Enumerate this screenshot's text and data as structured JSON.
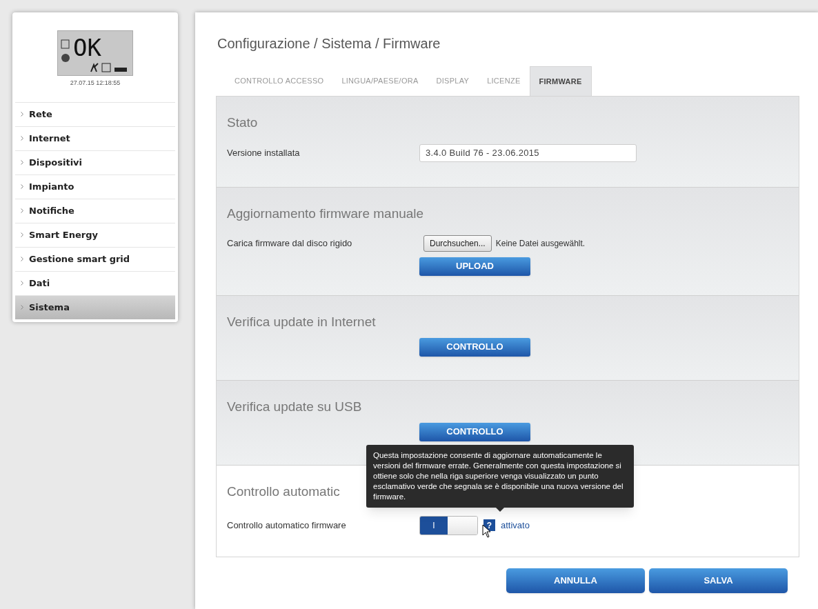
{
  "status_display": {
    "text": "OK",
    "timestamp": "27.07.15 12:18:55"
  },
  "sidebar": {
    "items": [
      {
        "label": "Rete",
        "selected": false
      },
      {
        "label": "Internet",
        "selected": false
      },
      {
        "label": "Dispositivi",
        "selected": false
      },
      {
        "label": "Impianto",
        "selected": false
      },
      {
        "label": "Notifiche",
        "selected": false
      },
      {
        "label": "Smart Energy",
        "selected": false
      },
      {
        "label": "Gestione smart grid",
        "selected": false
      },
      {
        "label": "Dati",
        "selected": false
      },
      {
        "label": "Sistema",
        "selected": true
      }
    ]
  },
  "breadcrumb": "Configurazione / Sistema / Firmware",
  "tabs": [
    {
      "label": "CONTROLLO ACCESSO",
      "selected": false
    },
    {
      "label": "LINGUA/PAESE/ORA",
      "selected": false
    },
    {
      "label": "DISPLAY",
      "selected": false
    },
    {
      "label": "LICENZE",
      "selected": false
    },
    {
      "label": "FIRMWARE",
      "selected": true
    }
  ],
  "sections": [
    {
      "title": "Stato",
      "rows": [
        {
          "kind": "field",
          "label": "Versione installata",
          "value": "3.4.0 Build 76 - 23.06.2015"
        }
      ]
    },
    {
      "title": "Aggiornamento firmware manuale",
      "rows": [
        {
          "kind": "file",
          "label": "Carica firmware dal disco rigido",
          "button": "Durchsuchen...",
          "status": "Keine Datei ausgewählt."
        },
        {
          "kind": "button",
          "label": "UPLOAD"
        }
      ]
    },
    {
      "title": "Verifica update in Internet",
      "rows": [
        {
          "kind": "button",
          "label": "CONTROLLO"
        }
      ]
    },
    {
      "title": "Verifica update su USB",
      "rows": [
        {
          "kind": "button",
          "label": "CONTROLLO"
        }
      ]
    },
    {
      "title": "Controllo automatic",
      "rows": [
        {
          "kind": "toggle",
          "label": "Controllo automatico firmware",
          "on": true,
          "toggle_text": "I",
          "help": "?",
          "state_text": "attivato",
          "tooltip": "Questa impostazione consente di aggiornare automaticamente le versioni del firmware errate. Generalmente con questa impostazione si ottiene solo che nella riga superiore venga visualizzato un punto esclamativo verde che segnala se è disponibile una nuova versione del firmware."
        }
      ]
    }
  ],
  "actions": [
    {
      "label": "ANNULLA"
    },
    {
      "label": "SALVA"
    }
  ]
}
